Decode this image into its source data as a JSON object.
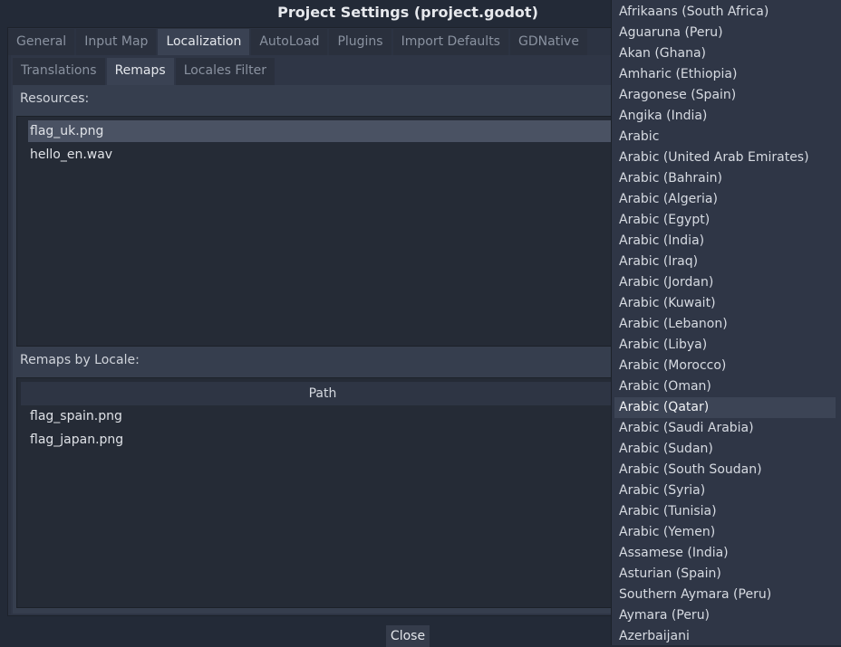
{
  "window": {
    "title": "Project Settings (project.godot)"
  },
  "tabs": [
    {
      "label": "General"
    },
    {
      "label": "Input Map"
    },
    {
      "label": "Localization",
      "active": true
    },
    {
      "label": "AutoLoad"
    },
    {
      "label": "Plugins"
    },
    {
      "label": "Import Defaults"
    },
    {
      "label": "GDNative"
    }
  ],
  "subtabs": [
    {
      "label": "Translations"
    },
    {
      "label": "Remaps",
      "active": true
    },
    {
      "label": "Locales Filter"
    }
  ],
  "resources": {
    "label": "Resources:",
    "items": [
      {
        "label": "flag_uk.png",
        "selected": true
      },
      {
        "label": "hello_en.wav"
      }
    ]
  },
  "remaps": {
    "label": "Remaps by Locale:",
    "column_header": "Path",
    "items": [
      {
        "label": "flag_spain.png"
      },
      {
        "label": "flag_japan.png"
      }
    ]
  },
  "footer": {
    "close_label": "Close"
  },
  "locale_popup": {
    "highlighted": "Arabic (Qatar)",
    "items": [
      "Afrikaans (South Africa)",
      "Aguaruna (Peru)",
      "Akan (Ghana)",
      "Amharic (Ethiopia)",
      "Aragonese (Spain)",
      "Angika (India)",
      "Arabic",
      "Arabic (United Arab Emirates)",
      "Arabic (Bahrain)",
      "Arabic (Algeria)",
      "Arabic (Egypt)",
      "Arabic (India)",
      "Arabic (Iraq)",
      "Arabic (Jordan)",
      "Arabic (Kuwait)",
      "Arabic (Lebanon)",
      "Arabic (Libya)",
      "Arabic (Morocco)",
      "Arabic (Oman)",
      "Arabic (Qatar)",
      "Arabic (Saudi Arabia)",
      "Arabic (Sudan)",
      "Arabic (South Soudan)",
      "Arabic (Syria)",
      "Arabic (Tunisia)",
      "Arabic (Yemen)",
      "Assamese (India)",
      "Asturian (Spain)",
      "Southern Aymara (Peru)",
      "Aymara (Peru)",
      "Azerbaijani"
    ]
  },
  "colors": {
    "background": "#232a37",
    "panel": "#363e4e",
    "list_background": "#252b36",
    "selection": "#4a5263",
    "popup_highlight": "#3c4455"
  }
}
